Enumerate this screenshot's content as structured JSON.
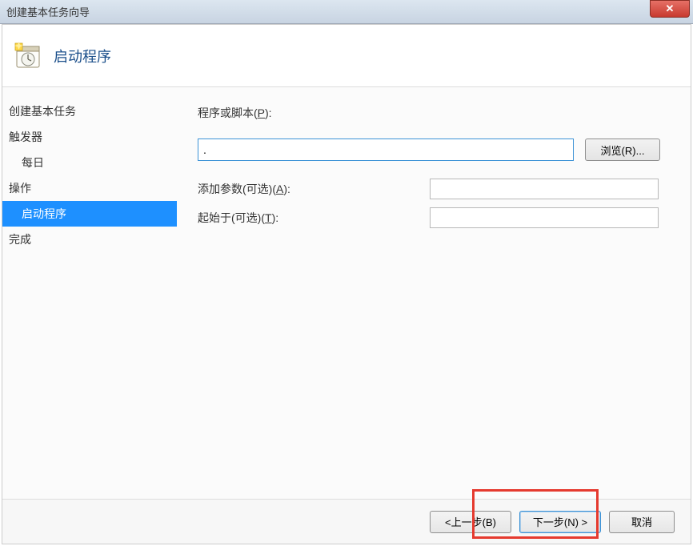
{
  "window": {
    "title": "创建基本任务向导",
    "close_glyph": "✕"
  },
  "header": {
    "title": "启动程序"
  },
  "sidebar": {
    "items": [
      {
        "label": "创建基本任务",
        "indent": false,
        "selected": false
      },
      {
        "label": "触发器",
        "indent": false,
        "selected": false
      },
      {
        "label": "每日",
        "indent": true,
        "selected": false
      },
      {
        "label": "操作",
        "indent": false,
        "selected": false
      },
      {
        "label": "启动程序",
        "indent": true,
        "selected": true
      },
      {
        "label": "完成",
        "indent": false,
        "selected": false
      }
    ]
  },
  "form": {
    "program_label_pre": "程序或脚本(",
    "program_label_u": "P",
    "program_label_post": "):",
    "program_value": ".",
    "browse_label": "浏览(R)...",
    "args_label_pre": "添加参数(可选)(",
    "args_label_u": "A",
    "args_label_post": "):",
    "args_value": "",
    "startin_label_pre": "起始于(可选)(",
    "startin_label_u": "T",
    "startin_label_post": "):",
    "startin_value": ""
  },
  "footer": {
    "back_label": "<上一步(B)",
    "next_label": "下一步(N) >",
    "cancel_label": "取消"
  }
}
